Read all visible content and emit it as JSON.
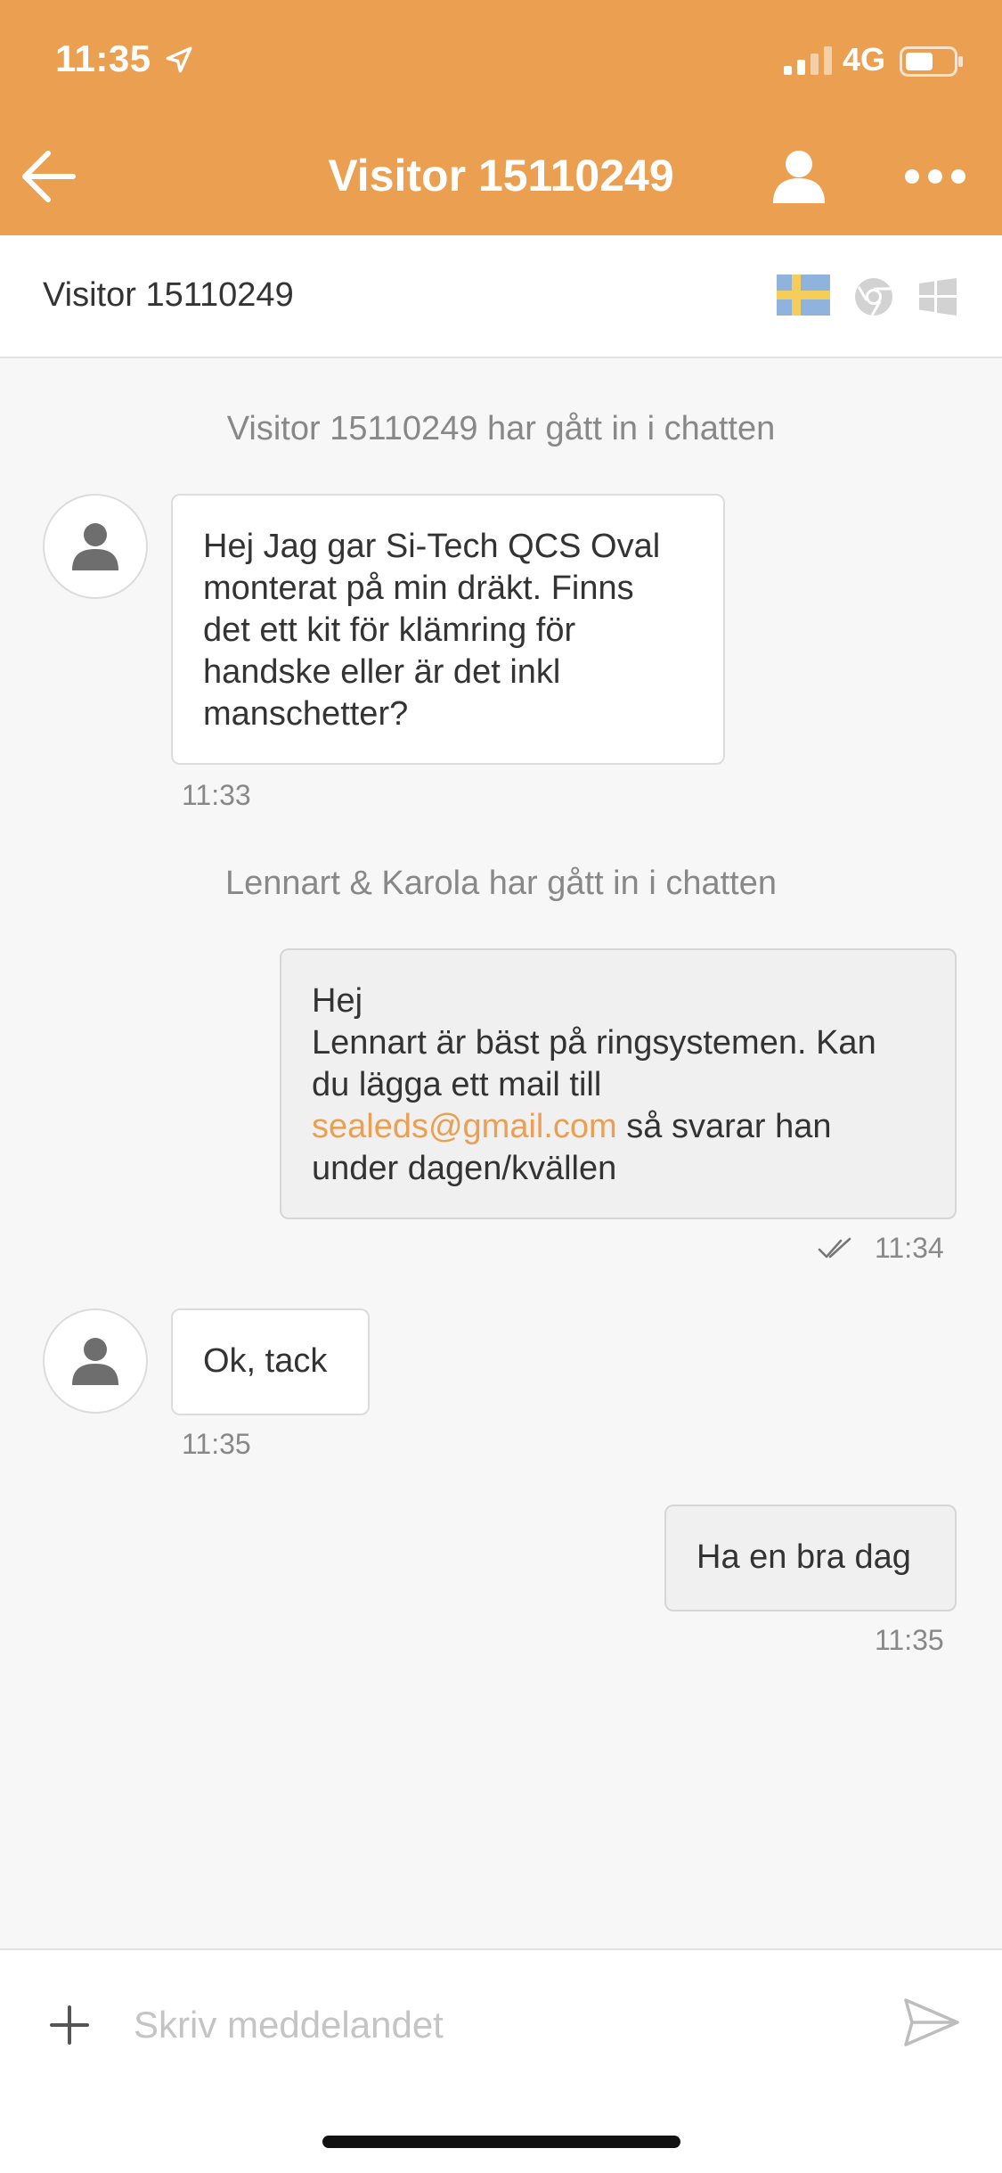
{
  "status_bar": {
    "time": "11:35",
    "network": "4G"
  },
  "header": {
    "title": "Visitor 15110249",
    "icons": {
      "back": "arrow-left",
      "profile": "person",
      "more": "ellipsis"
    }
  },
  "visitor_bar": {
    "name": "Visitor 15110249",
    "icons": {
      "language": "flag-sweden",
      "browser": "chrome",
      "os": "windows"
    }
  },
  "messages": {
    "sys1": "Visitor 15110249 har gått in i chatten",
    "m1": {
      "lines": [
        "Hej Jag gar Si-Tech QCS Oval",
        "monterat på min dräkt. Finns",
        "det ett kit för klämring för",
        "handske eller är det inkl",
        "manschetter?"
      ],
      "time": "11:33"
    },
    "sys2": "Lennart & Karola har gått in i chatten",
    "m2": {
      "line1": "Hej",
      "line2": "Lennart är bäst på ringsystemen. Kan",
      "line3": "du lägga ett mail till",
      "link": "sealeds@gmail.com",
      "line4_rest": " så svarar han",
      "line5": "under dagen/kvällen",
      "time": "11:34"
    },
    "m3": {
      "text": "Ok, tack",
      "time": "11:35"
    },
    "m4": {
      "text": "Ha en bra dag",
      "time": "11:35"
    }
  },
  "composer": {
    "placeholder": "Skriv meddelandet"
  },
  "colors": {
    "accent": "#eb9f51",
    "background": "#f7f7f7"
  }
}
